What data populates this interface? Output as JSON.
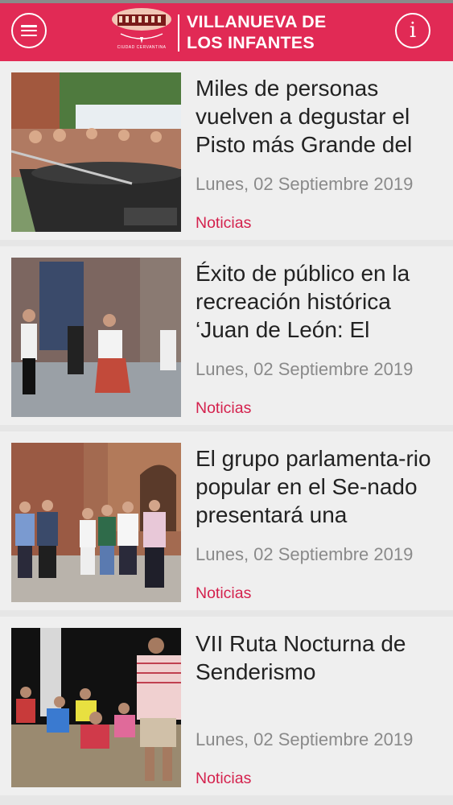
{
  "app": {
    "title": "VILLANUEVA DE LOS INFANTES",
    "logo_subtext": "CIUDAD CERVANTINA",
    "menu_icon": "hamburger-menu-icon",
    "info_icon": "info-icon",
    "brand_color": "#e12a55",
    "category_color": "#d4214d"
  },
  "articles": [
    {
      "title": "Miles de personas vuelven a degustar el Pisto más Grande del",
      "date": "Lunes, 02 Septiembre 2019",
      "category": "Noticias",
      "image": "pisto-festival-photo"
    },
    {
      "title": "Éxito de público en la recreación histórica ‘Juan de León: El",
      "date": "Lunes, 02 Septiembre 2019",
      "category": "Noticias",
      "image": "historical-reenactment-photo"
    },
    {
      "title": "El grupo parlamenta-rio popular en el Se-nado presentará una",
      "date": "Lunes, 02 Septiembre 2019",
      "category": "Noticias",
      "image": "senate-group-photo"
    },
    {
      "title": "VII Ruta Nocturna de Senderismo",
      "date": "Lunes, 02 Septiembre 2019",
      "category": "Noticias",
      "image": "night-hiking-photo"
    }
  ]
}
